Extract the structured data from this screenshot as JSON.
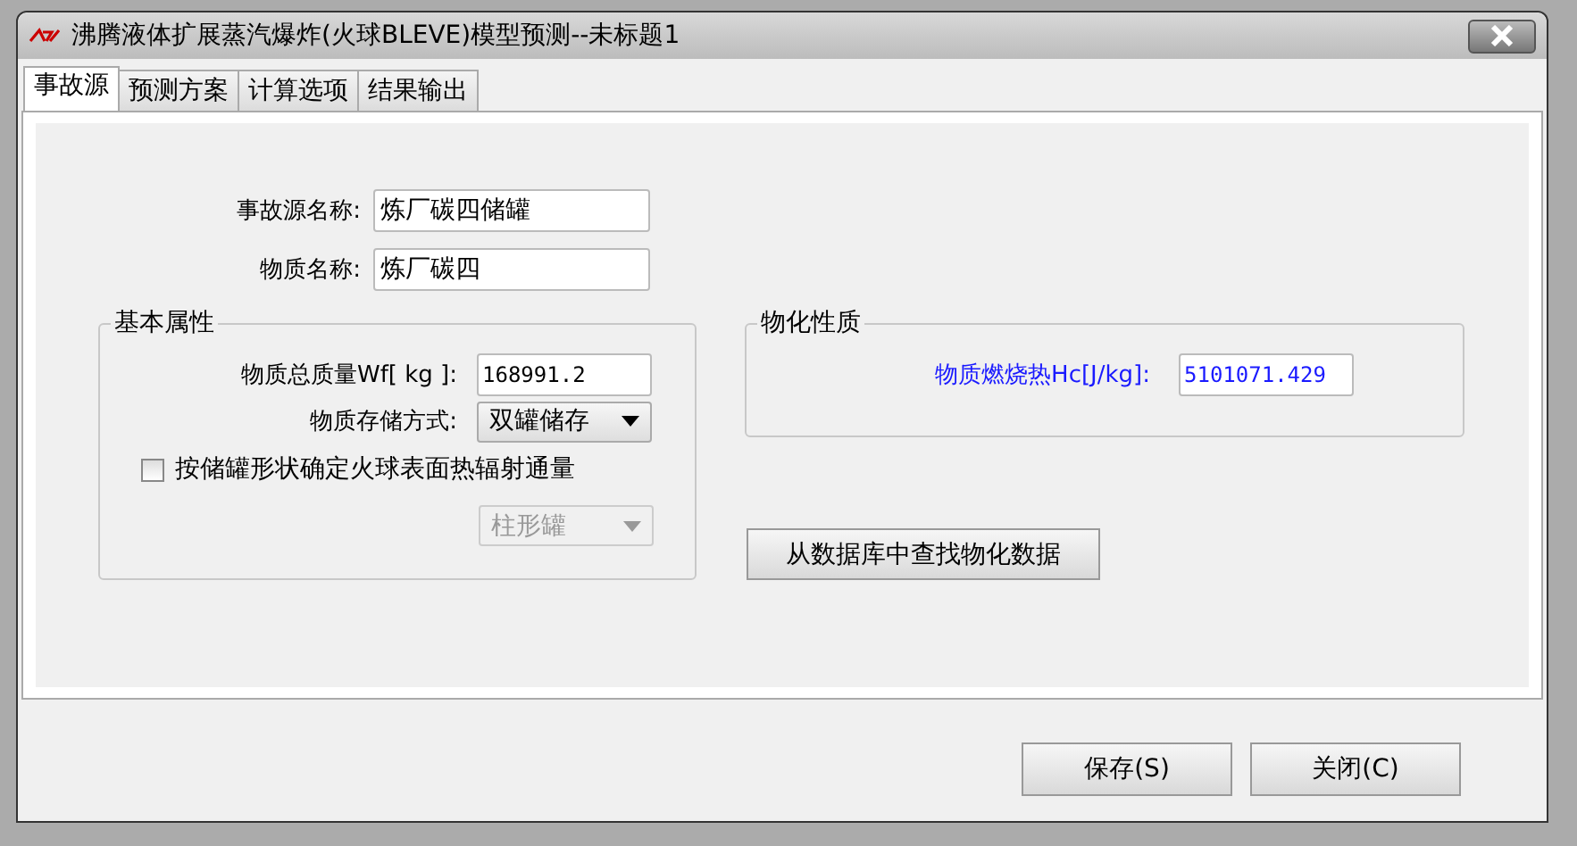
{
  "window": {
    "title": "沸腾液体扩展蒸汽爆炸(火球BLEVE)模型预测--未标题1"
  },
  "tabs": [
    {
      "label": "事故源",
      "selected": true
    },
    {
      "label": "预测方案",
      "selected": false
    },
    {
      "label": "计算选项",
      "selected": false
    },
    {
      "label": "结果输出",
      "selected": false
    }
  ],
  "source_fields": [
    {
      "label": "事故源名称:",
      "value": "炼厂碳四储罐"
    },
    {
      "label": "物质名称:",
      "value": "炼厂碳四"
    }
  ],
  "basic_properties": {
    "title": "基本属性",
    "mass_label": "物质总质量Wf[ kg ]:",
    "mass_value": "168991.2",
    "storage_label": "物质存储方式:",
    "storage_value": "双罐储存",
    "shape_checkbox": {
      "label": "按储罐形状确定火球表面热辐射通量",
      "checked": false
    },
    "shape_dropdown": {
      "value": "柱形罐",
      "disabled": true
    }
  },
  "physical_properties": {
    "title": "物化性质",
    "heat_label": "物质燃烧热Hc[J/kg]:",
    "heat_value": "5101071.429"
  },
  "lookup_button": "从数据库中查找物化数据",
  "buttons": [
    "保存(S)",
    "关闭(C)"
  ]
}
